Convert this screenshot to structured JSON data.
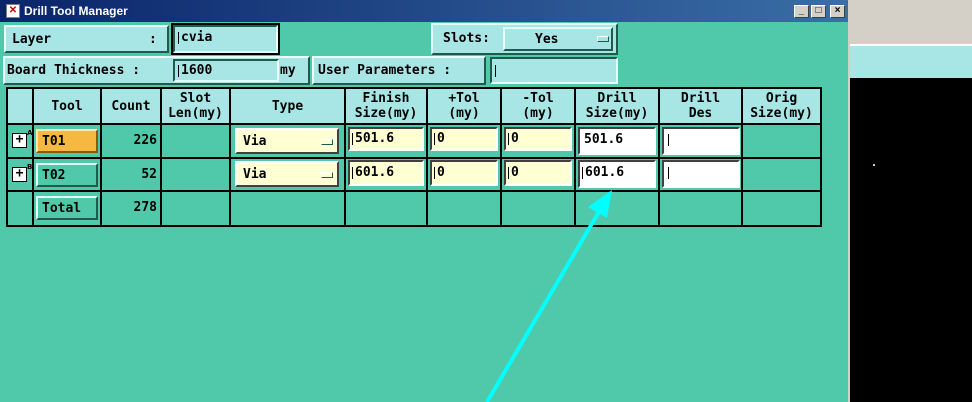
{
  "window": {
    "title": "Drill Tool Manager",
    "minimize": "_",
    "maximize": "□",
    "close": "×"
  },
  "controls": {
    "layer_label": "Layer",
    "layer_colon": ":",
    "layer_value": "cvia",
    "slots_label": "Slots:",
    "slots_value": "Yes",
    "board_thickness_label": "Board Thickness :",
    "board_thickness_value": "1600",
    "board_thickness_unit": "my",
    "user_params_label": "User Parameters :",
    "user_params_value": ""
  },
  "table": {
    "headers": {
      "tool": "Tool",
      "count": "Count",
      "slot_len": [
        "Slot",
        "Len(my)"
      ],
      "type": "Type",
      "finish_size": [
        "Finish",
        "Size(my)"
      ],
      "plus_tol": [
        "+Tol",
        "(my)"
      ],
      "minus_tol": [
        "-Tol",
        "(my)"
      ],
      "drill_size": [
        "Drill",
        "Size(my)"
      ],
      "drill_des": [
        "Drill",
        "Des"
      ],
      "orig_size": [
        "Orig",
        "Size(my)"
      ]
    },
    "rows": [
      {
        "expander": "+",
        "expander_sup": "A",
        "tool": "T01",
        "count": "226",
        "type": "Via",
        "finish_size": "501.6",
        "plus_tol": "0",
        "minus_tol": "0",
        "drill_size": "501.6",
        "drill_des": ""
      },
      {
        "expander": "+",
        "expander_sup": "B",
        "tool": "T02",
        "count": "52",
        "type": "Via",
        "finish_size": "601.6",
        "plus_tol": "0",
        "minus_tol": "0",
        "drill_size": "601.6",
        "drill_des": ""
      }
    ],
    "total": {
      "label": "Total",
      "count": "278"
    }
  },
  "colors": {
    "window_bg": "#4fc9a9",
    "panel_bg": "#a8e6e6",
    "selected_tool": "#f5b942",
    "annotation_arrow": "#00ffff"
  }
}
